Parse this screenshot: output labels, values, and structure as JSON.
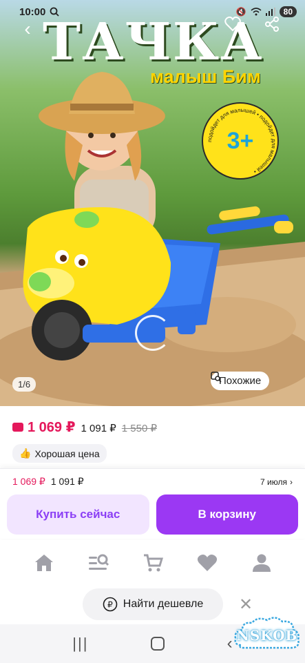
{
  "status_bar": {
    "time": "10:00",
    "battery": "80"
  },
  "hero": {
    "title": "ТАЧКА",
    "subtitle": "малыш Бим",
    "age_badge": "3+",
    "age_badge_ring": "подойдет для малышей • подойдет для малышей •",
    "counter": "1/6",
    "similar_label": "Похожие"
  },
  "price": {
    "main": "1 069 ₽",
    "card": "1 091 ₽",
    "old": "1 550 ₽",
    "good_price_label": "Хорошая цена"
  },
  "buy_sheet": {
    "price_main": "1 069 ₽",
    "price_card": "1 091 ₽",
    "delivery": "7 июля",
    "buy_now_label": "Купить сейчас",
    "cart_label": "В корзину"
  },
  "tabs": [
    "home-icon",
    "catalog-search-icon",
    "cart-icon",
    "heart-icon",
    "profile-icon"
  ],
  "cheaper": {
    "label": "Найти дешевле"
  },
  "watermark": {
    "text": "NSKOB"
  },
  "colors": {
    "accent": "#9b38f3",
    "price": "#e4185b",
    "buy_now_bg": "#f2e5ff"
  }
}
